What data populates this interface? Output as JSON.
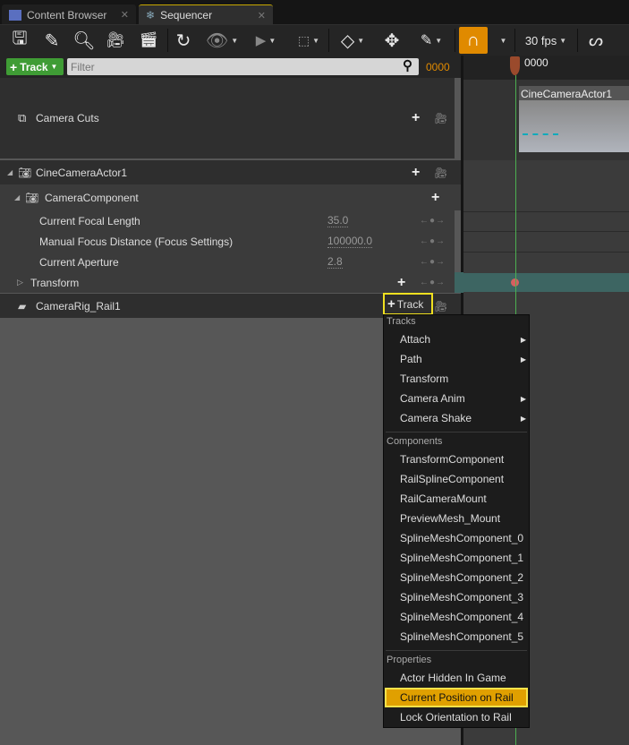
{
  "tabs": [
    {
      "label": "Content Browser",
      "icon": "content-browser-icon"
    },
    {
      "label": "Sequencer",
      "icon": "sequencer-icon",
      "active": true
    }
  ],
  "toolbar": {
    "fps": "30 fps",
    "accent": "#e08a00"
  },
  "filter": {
    "add_track": "Track",
    "placeholder": "Filter",
    "frame": "0000"
  },
  "timeline": {
    "current_frame": "0000",
    "clip_label": "CineCameraActor1",
    "playhead_color": "#4caf50"
  },
  "tree": {
    "camera_cuts": "Camera Cuts",
    "actor": "CineCameraActor1",
    "component": "CameraComponent",
    "properties": [
      {
        "label": "Current Focal Length",
        "value": "35.0"
      },
      {
        "label": "Manual Focus Distance (Focus Settings)",
        "value": "100000.0"
      },
      {
        "label": "Current Aperture",
        "value": "2.8"
      }
    ],
    "transform": "Transform",
    "rail": "CameraRig_Rail1",
    "rail_track_button": "Track"
  },
  "menu": {
    "tracks_header": "Tracks",
    "tracks": [
      {
        "label": "Attach",
        "submenu": true
      },
      {
        "label": "Path",
        "submenu": true
      },
      {
        "label": "Transform"
      },
      {
        "label": "Camera Anim",
        "submenu": true
      },
      {
        "label": "Camera Shake",
        "submenu": true
      }
    ],
    "components_header": "Components",
    "components": [
      "TransformComponent",
      "RailSplineComponent",
      "RailCameraMount",
      "PreviewMesh_Mount",
      "SplineMeshComponent_0",
      "SplineMeshComponent_1",
      "SplineMeshComponent_2",
      "SplineMeshComponent_3",
      "SplineMeshComponent_4",
      "SplineMeshComponent_5"
    ],
    "properties_header": "Properties",
    "properties": [
      "Actor Hidden In Game",
      "Current Position on Rail",
      "Lock Orientation to Rail"
    ],
    "highlighted": "Current Position on Rail"
  }
}
